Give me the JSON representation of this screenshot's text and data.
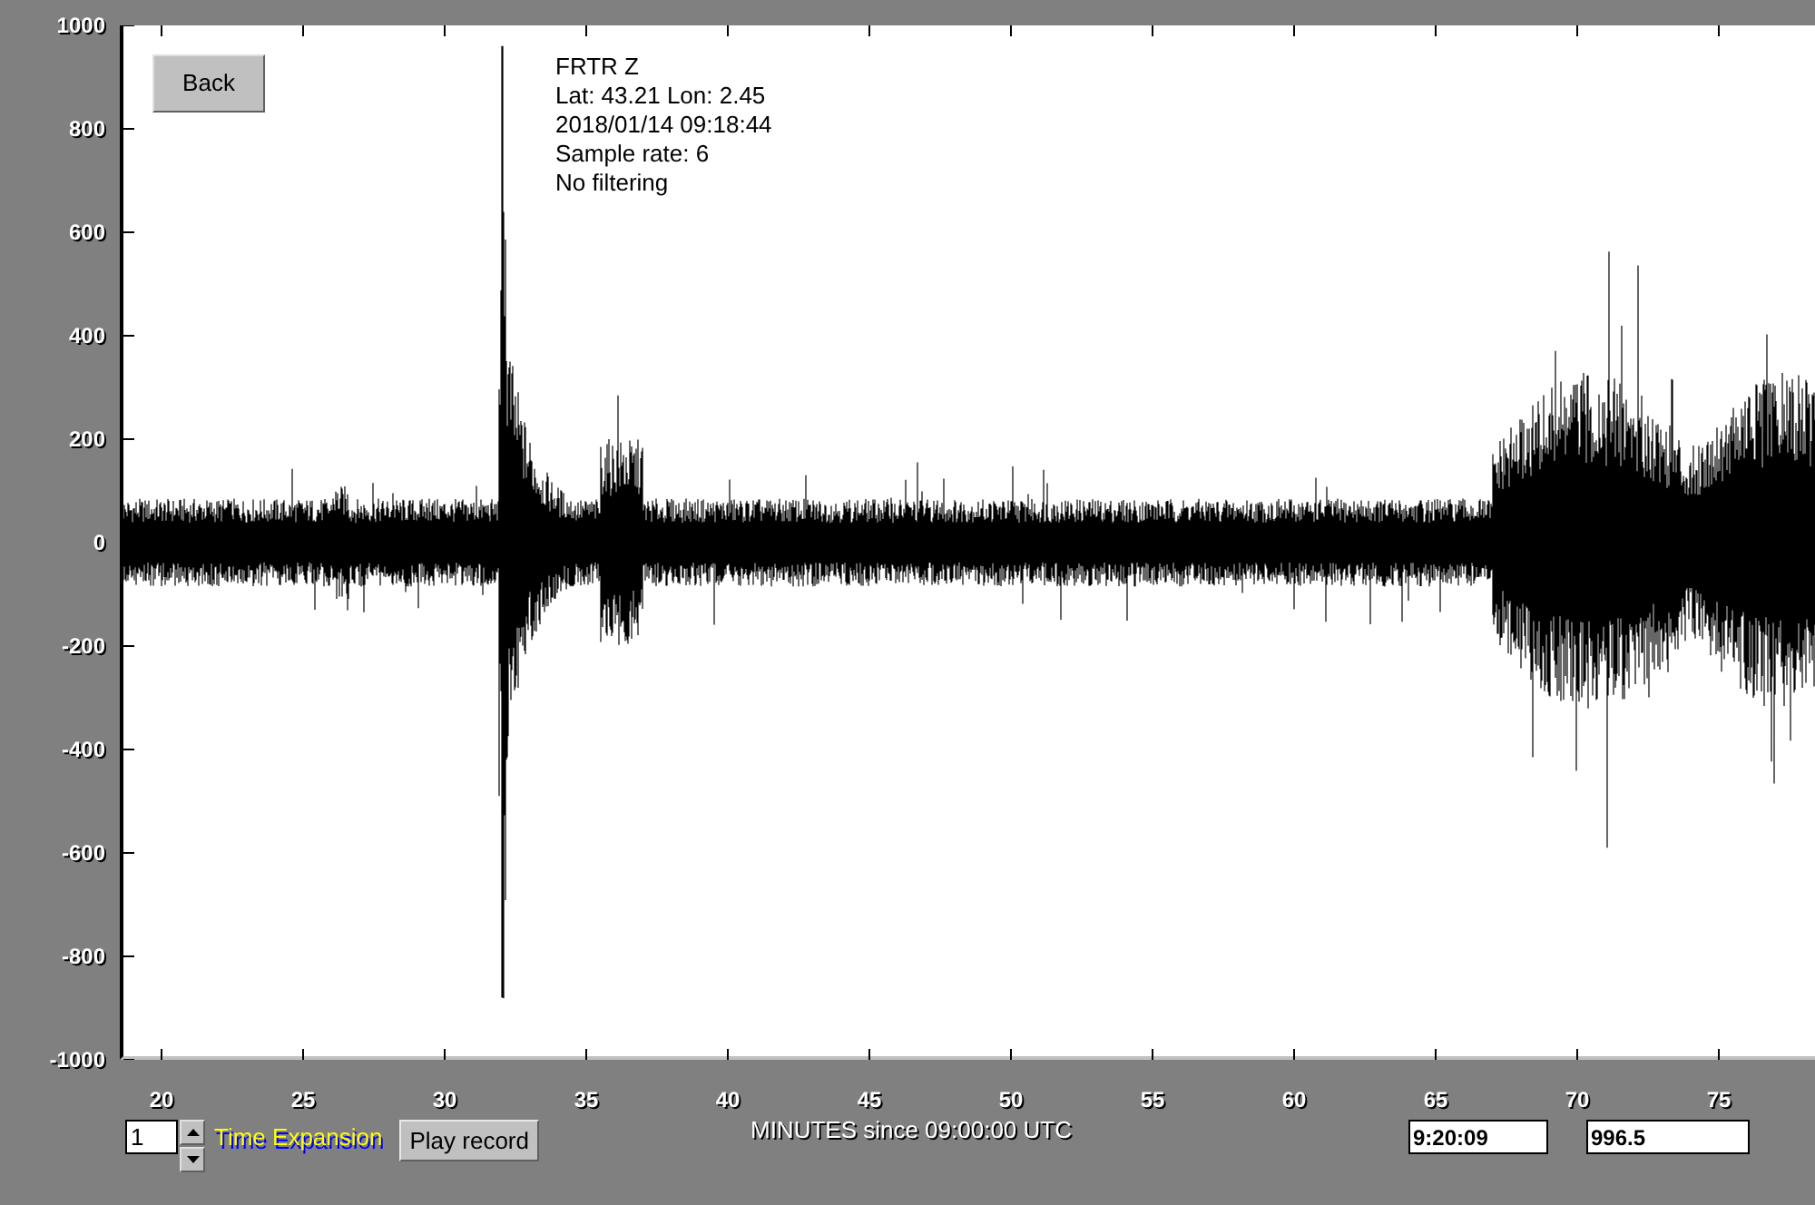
{
  "plot": {
    "y_ticks": [
      "1000",
      "800",
      "600",
      "400",
      "200",
      "0",
      "-200",
      "-400",
      "-600",
      "-800",
      "-1000"
    ],
    "x_ticks": [
      "20",
      "25",
      "30",
      "35",
      "40",
      "45",
      "50",
      "55",
      "60",
      "65",
      "70",
      "75"
    ],
    "info_lines": [
      "FRTR  Z",
      "Lat: 43.21 Lon: 2.45",
      "2018/01/14 09:18:44",
      "Sample rate: 6",
      "No filtering"
    ],
    "x_axis_label": "MINUTES since 09:00:00 UTC"
  },
  "back_button": "Back",
  "time_expansion": {
    "value": "1",
    "label": "Time Expansion"
  },
  "play_button": "Play record",
  "time_field": "9:20:09",
  "amplitude_field": "996.5"
}
